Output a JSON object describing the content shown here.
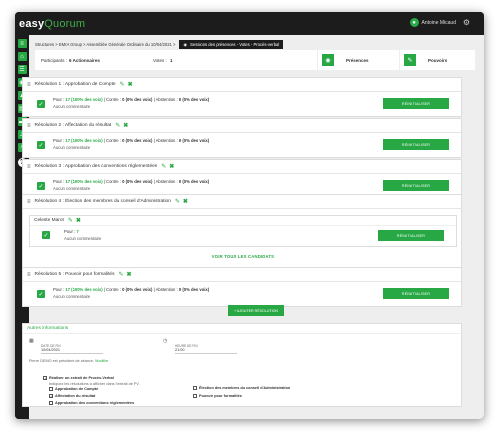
{
  "app": {
    "logo_prefix": "easy",
    "logo_suffix": "Quorum",
    "user_name": "Antoine Micaud"
  },
  "breadcrumb": {
    "path": "Structures > EMrA Group > Assemblée Générale Ordinaire du 10/04/2021 >",
    "active": "Sessions des présences - Votes - Procès-verbal"
  },
  "info": {
    "participants_label": "Participants :",
    "participants_value": "6 Actionnaires",
    "votes_label": "Votes :",
    "votes_value": "1",
    "presences_label": "Présences",
    "pouvoirs_label": "Pouvoirs"
  },
  "resolutions": [
    {
      "title": "Résolution 1 : Approbation de Compte",
      "vote_pour": "17 (100% des voix)",
      "vote_contre": "0 (0% des voix)",
      "vote_abstention": "0 (0% des voix)",
      "comment": "Aucun commentaire",
      "reset": "RÉINITIALISER"
    },
    {
      "title": "Résolution 2 : Affectation du résultat",
      "vote_pour": "17 (100% des voix)",
      "vote_contre": "0 (0% des voix)",
      "vote_abstention": "0 (0% des voix)",
      "comment": "Aucun commentaire",
      "reset": "RÉINITIALISER"
    },
    {
      "title": "Résolution 3 : Approbation des conventions réglementées",
      "vote_pour": "17 (100% des voix)",
      "vote_contre": "0 (0% des voix)",
      "vote_abstention": "0 (0% des voix)",
      "comment": "Aucun commentaire",
      "reset": "RÉINITIALISER"
    },
    {
      "title": "Résolution 4 : Élection des membres du conseil d'Administration",
      "person": "Celeste Marot",
      "vote_pour": "7",
      "comment": "Aucun commentaire",
      "reset": "RÉINITIALISER",
      "voir": "VOIR TOUS LES CANDIDATS"
    },
    {
      "title": "Résolution 5 : Pouvoir pour formalités",
      "vote_pour": "17 (100% des voix)",
      "vote_contre": "0 (0% des voix)",
      "vote_abstention": "0 (0% des voix)",
      "comment": "Aucun commentaire",
      "reset": "RÉINITIALISER"
    }
  ],
  "labels": {
    "pour": "Pour :",
    "contre": "Contre :",
    "abstention": "Abstention :",
    "sep": "|",
    "add_resolution": "+ AJOUTER RÉSOLUTION"
  },
  "other_info": {
    "heading": "Autres informations",
    "date_label": "DATE DE FIN",
    "date_value": "10/04/2021",
    "hour_label": "HEURE DE FIN",
    "hour_value": "21:00",
    "president_text": "Pierre DEMO est président de séance.",
    "modifier": "Modifier",
    "pv_label": "Réaliser un extrait de Procès-Verbal",
    "pv_hint": "Indiquez les résolutions à afficher dans l'extrait de PV.",
    "checks": [
      {
        "label": "Approbation de Compte",
        "checked": false
      },
      {
        "label": "Affectation du résultat",
        "checked": true
      },
      {
        "label": "Approbation des conventions réglementées",
        "checked": false
      },
      {
        "label": "Élection des membres du conseil d'Administration",
        "checked": false
      },
      {
        "label": "Pouvoir pour formalités",
        "checked": false
      }
    ]
  },
  "colors": {
    "accent": "#27a844",
    "dark": "#1c1c1c",
    "background": "#eeeeee"
  },
  "icons": {
    "sidebar": [
      "menu-icon",
      "home-icon",
      "list-icon",
      "eye-icon",
      "chart-icon",
      "file-icon",
      "folder-icon",
      "hierarchy-icon",
      "search-icon",
      "help-icon"
    ]
  }
}
